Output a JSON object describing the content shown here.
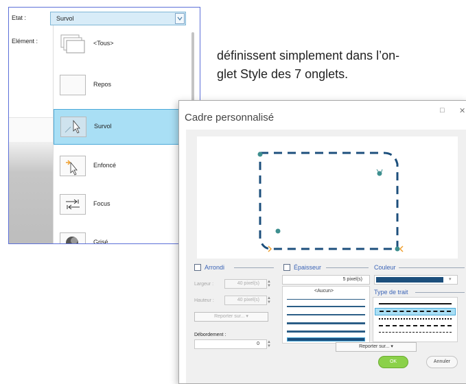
{
  "panel1": {
    "etat_label": "Etat :",
    "element_label": "Elément :",
    "etat_value": "Survol",
    "items": [
      {
        "label": "<Tous>"
      },
      {
        "label": "Repos"
      },
      {
        "label": "Survol"
      },
      {
        "label": "Enfoncé"
      },
      {
        "label": "Focus"
      },
      {
        "label": "Grisé"
      }
    ]
  },
  "text": {
    "line1": "définissent simplement dans l’on-",
    "line2": "glet Style des 7 onglets."
  },
  "dialog": {
    "title": "Cadre personnalisé",
    "restore_glyph": "□",
    "close_glyph": "✕",
    "arrondi": {
      "label": "Arrondi",
      "largeur_label": "Largeur :",
      "largeur_value": "40 pixel(s)",
      "hauteur_label": "Hauteur :",
      "hauteur_value": "40 pixel(s)",
      "reporter_label": "Reporter sur..."
    },
    "debordement": {
      "label": "Débordement :",
      "value": "0"
    },
    "epaisseur": {
      "label": "Épaisseur",
      "value": "5 pixel(s)",
      "aucun": "<Aucun>"
    },
    "couleur": {
      "label": "Couleur",
      "color": "#1c4f7c"
    },
    "type_trait": {
      "label": "Type de trait"
    },
    "reporter2_label": "Reporter sur...",
    "ok_label": "OK",
    "annuler_label": "Annuler"
  },
  "colors": {
    "accent": "#3b64b6",
    "frame": "#1c4f7c",
    "handle": "#3e8f8f",
    "selected": "#a9dff5",
    "ok": "#8bd14a"
  }
}
